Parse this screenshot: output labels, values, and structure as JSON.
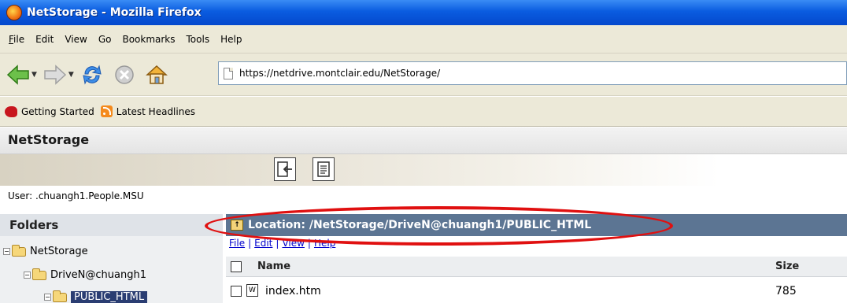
{
  "window": {
    "title": "NetStorage - Mozilla Firefox"
  },
  "menu": [
    "File",
    "Edit",
    "View",
    "Go",
    "Bookmarks",
    "Tools",
    "Help"
  ],
  "menu_mnemonics": [
    "F",
    "E",
    "V",
    "G",
    "B",
    "T",
    "H"
  ],
  "toolbar": {
    "url": "https://netdrive.montclair.edu/NetStorage/",
    "icons": [
      "back-arrow-icon",
      "forward-arrow-icon",
      "reload-icon",
      "stop-icon",
      "home-icon"
    ]
  },
  "bookmarks": [
    {
      "label": "Getting Started",
      "icon": "firefox-start-icon"
    },
    {
      "label": "Latest Headlines",
      "icon": "rss-feed-icon"
    }
  ],
  "app": {
    "title": "NetStorage",
    "user_line": "User: .chuangh1.People.MSU"
  },
  "folders": {
    "heading": "Folders",
    "tree": [
      {
        "label": "NetStorage",
        "level": 0
      },
      {
        "label": "DriveN@chuangh1",
        "level": 1
      },
      {
        "label": "PUBLIC_HTML",
        "level": 2,
        "selected": true
      }
    ]
  },
  "main": {
    "location": "Location: /NetStorage/DriveN@chuangh1/PUBLIC_HTML",
    "menu": [
      "File",
      "Edit",
      "View",
      "Help"
    ],
    "columns": {
      "name": "Name",
      "size": "Size"
    },
    "files": [
      {
        "name": "index.htm",
        "size": "785"
      }
    ]
  },
  "colors": {
    "titlebar": "#0a5ce0",
    "location_header": "#5c7593",
    "selection": "#2a3d72",
    "annotation": "#e01010"
  }
}
